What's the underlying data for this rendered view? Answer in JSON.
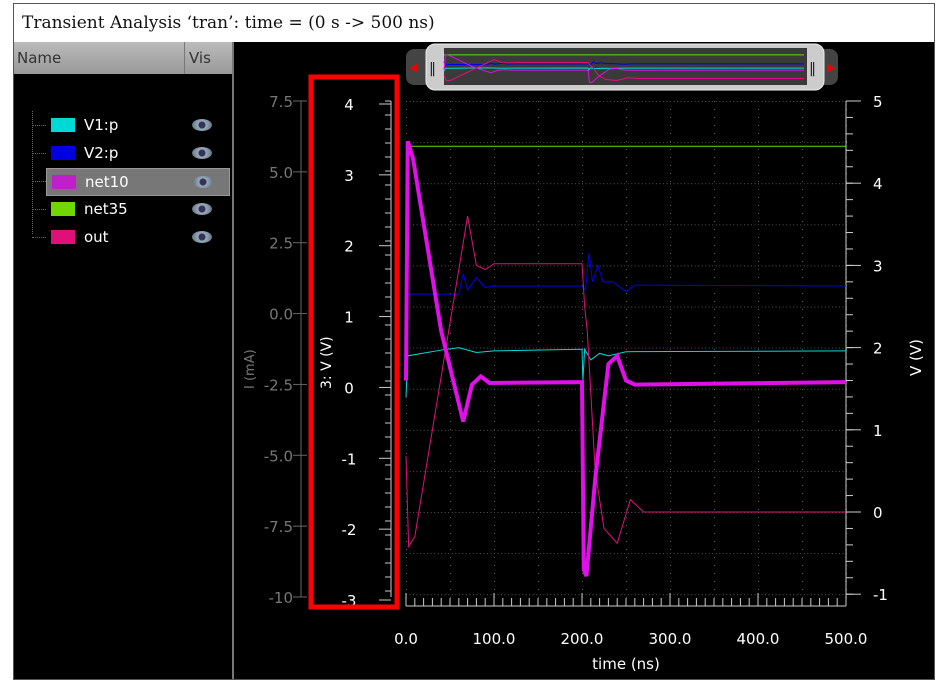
{
  "title": "Transient Analysis ‘tran’: time = (0 s -> 500 ns)",
  "sidebar": {
    "col_name": "Name",
    "col_vis": "Vis",
    "items": [
      {
        "label": "V1:p",
        "color": "#00d8d8"
      },
      {
        "label": "V2:p",
        "color": "#0000e0"
      },
      {
        "label": "net10",
        "color": "#c020c8",
        "selected": true
      },
      {
        "label": "net35",
        "color": "#70d800"
      },
      {
        "label": "out",
        "color": "#e0107a"
      }
    ]
  },
  "axes": {
    "left_i": {
      "label": "I (mA)",
      "ticks": [
        "7.5",
        "5.0",
        "2.5",
        "0.0",
        "-2.5",
        "-5.0",
        "-7.5",
        "-10"
      ]
    },
    "left_v": {
      "label": "3: V (V)",
      "ticks": [
        "4",
        "3",
        "2",
        "1",
        "0",
        "-1",
        "-2",
        "-3"
      ]
    },
    "right_v": {
      "label": "V (V)",
      "ticks": [
        "5",
        "4",
        "3",
        "2",
        "1",
        "0",
        "-1"
      ]
    },
    "x": {
      "label": "time (ns)",
      "ticks": [
        "0.0",
        "100.0",
        "200.0",
        "300.0",
        "400.0",
        "500.0"
      ]
    }
  },
  "chart_data": {
    "type": "line",
    "xlabel": "time (ns)",
    "ylabel": "V (V)",
    "xlim": [
      0,
      500
    ],
    "ylim": [
      -1,
      5
    ],
    "series": [
      {
        "name": "net35",
        "color": "#70d800",
        "width": 1,
        "points": [
          [
            0,
            4.45
          ],
          [
            500,
            4.45
          ]
        ]
      },
      {
        "name": "V2:p",
        "color": "#0000e0",
        "width": 1,
        "points": [
          [
            0,
            3.2
          ],
          [
            1,
            2.65
          ],
          [
            60,
            2.65
          ],
          [
            65,
            2.9
          ],
          [
            70,
            2.7
          ],
          [
            80,
            2.85
          ],
          [
            90,
            2.73
          ],
          [
            100,
            2.75
          ],
          [
            200,
            2.75
          ],
          [
            204,
            2.7
          ],
          [
            208,
            3.15
          ],
          [
            212,
            2.8
          ],
          [
            218,
            3.0
          ],
          [
            224,
            2.8
          ],
          [
            235,
            2.8
          ],
          [
            250,
            2.68
          ],
          [
            260,
            2.76
          ],
          [
            500,
            2.75
          ]
        ]
      },
      {
        "name": "V1:p",
        "color": "#00d8d8",
        "width": 1,
        "points": [
          [
            0,
            1.4
          ],
          [
            2,
            1.9
          ],
          [
            40,
            1.97
          ],
          [
            60,
            2.0
          ],
          [
            80,
            1.94
          ],
          [
            100,
            1.96
          ],
          [
            200,
            1.98
          ],
          [
            201,
            1.6
          ],
          [
            203,
            1.98
          ],
          [
            210,
            1.85
          ],
          [
            220,
            1.93
          ],
          [
            230,
            1.9
          ],
          [
            250,
            1.95
          ],
          [
            500,
            1.96
          ]
        ]
      },
      {
        "name": "out",
        "color": "#e0107a",
        "width": 1,
        "points": [
          [
            0,
            0.68
          ],
          [
            3,
            -0.42
          ],
          [
            10,
            -0.3
          ],
          [
            70,
            3.6
          ],
          [
            80,
            3.0
          ],
          [
            90,
            2.95
          ],
          [
            100,
            3.02
          ],
          [
            200,
            3.02
          ],
          [
            203,
            2.5
          ],
          [
            206,
            2.2
          ],
          [
            215,
            0.5
          ],
          [
            225,
            -0.2
          ],
          [
            240,
            -0.38
          ],
          [
            255,
            0.15
          ],
          [
            270,
            0.0
          ],
          [
            500,
            0.0
          ]
        ]
      },
      {
        "name": "net10",
        "color": "#e010e8",
        "width": 4,
        "points": [
          [
            0,
            1.6
          ],
          [
            2,
            4.51
          ],
          [
            8,
            4.3
          ],
          [
            40,
            2.2
          ],
          [
            65,
            1.1
          ],
          [
            75,
            1.55
          ],
          [
            85,
            1.65
          ],
          [
            95,
            1.57
          ],
          [
            200,
            1.58
          ],
          [
            202,
            -0.7
          ],
          [
            205,
            -0.78
          ],
          [
            215,
            0.4
          ],
          [
            230,
            1.8
          ],
          [
            240,
            1.9
          ],
          [
            250,
            1.6
          ],
          [
            260,
            1.55
          ],
          [
            500,
            1.58
          ]
        ]
      }
    ]
  }
}
